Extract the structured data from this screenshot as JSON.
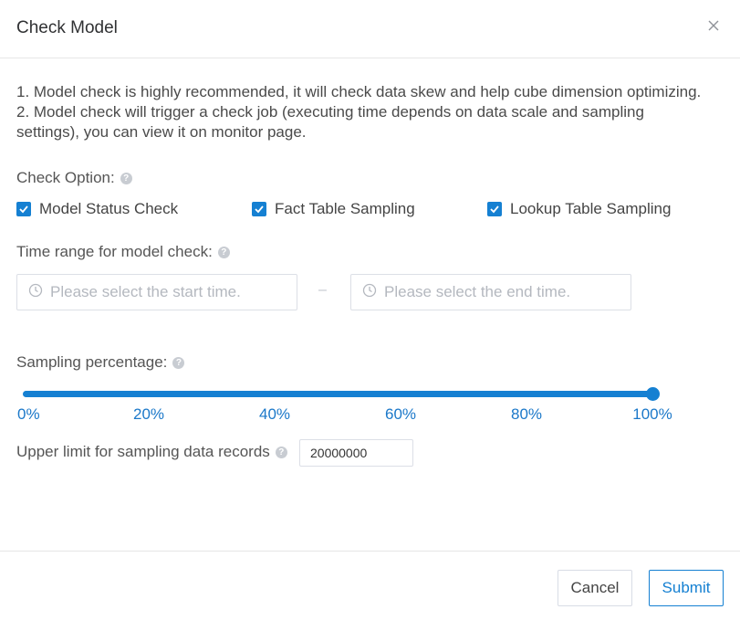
{
  "dialog": {
    "title": "Check Model",
    "close_icon": "close-icon"
  },
  "intro": {
    "line1": "1. Model check is highly recommended, it will check data skew and help cube dimension optimizing.",
    "line2": "2. Model check will trigger a check job (executing time depends on data scale and sampling",
    "line3": "settings), you can view it on monitor page."
  },
  "check_option": {
    "label": "Check Option:",
    "help_icon": "question-circle-icon",
    "options": [
      {
        "label": "Model Status Check",
        "checked": true
      },
      {
        "label": "Fact Table Sampling",
        "checked": true
      },
      {
        "label": "Lookup Table Sampling",
        "checked": true
      }
    ]
  },
  "time_range": {
    "label": "Time range for model check:",
    "start_placeholder": "Please select the start time.",
    "end_placeholder": "Please select the end time.",
    "separator": "–",
    "icon": "clock-icon"
  },
  "sampling": {
    "label": "Sampling percentage:",
    "value_percent": 100,
    "ticks": [
      "0%",
      "20%",
      "40%",
      "60%",
      "80%",
      "100%"
    ]
  },
  "upper_limit": {
    "label": "Upper limit for sampling data records",
    "value": "20000000"
  },
  "footer": {
    "cancel_label": "Cancel",
    "submit_label": "Submit"
  },
  "colors": {
    "accent": "#1580d2",
    "tick_text": "#1b78c9",
    "border": "#dcdfe6"
  }
}
